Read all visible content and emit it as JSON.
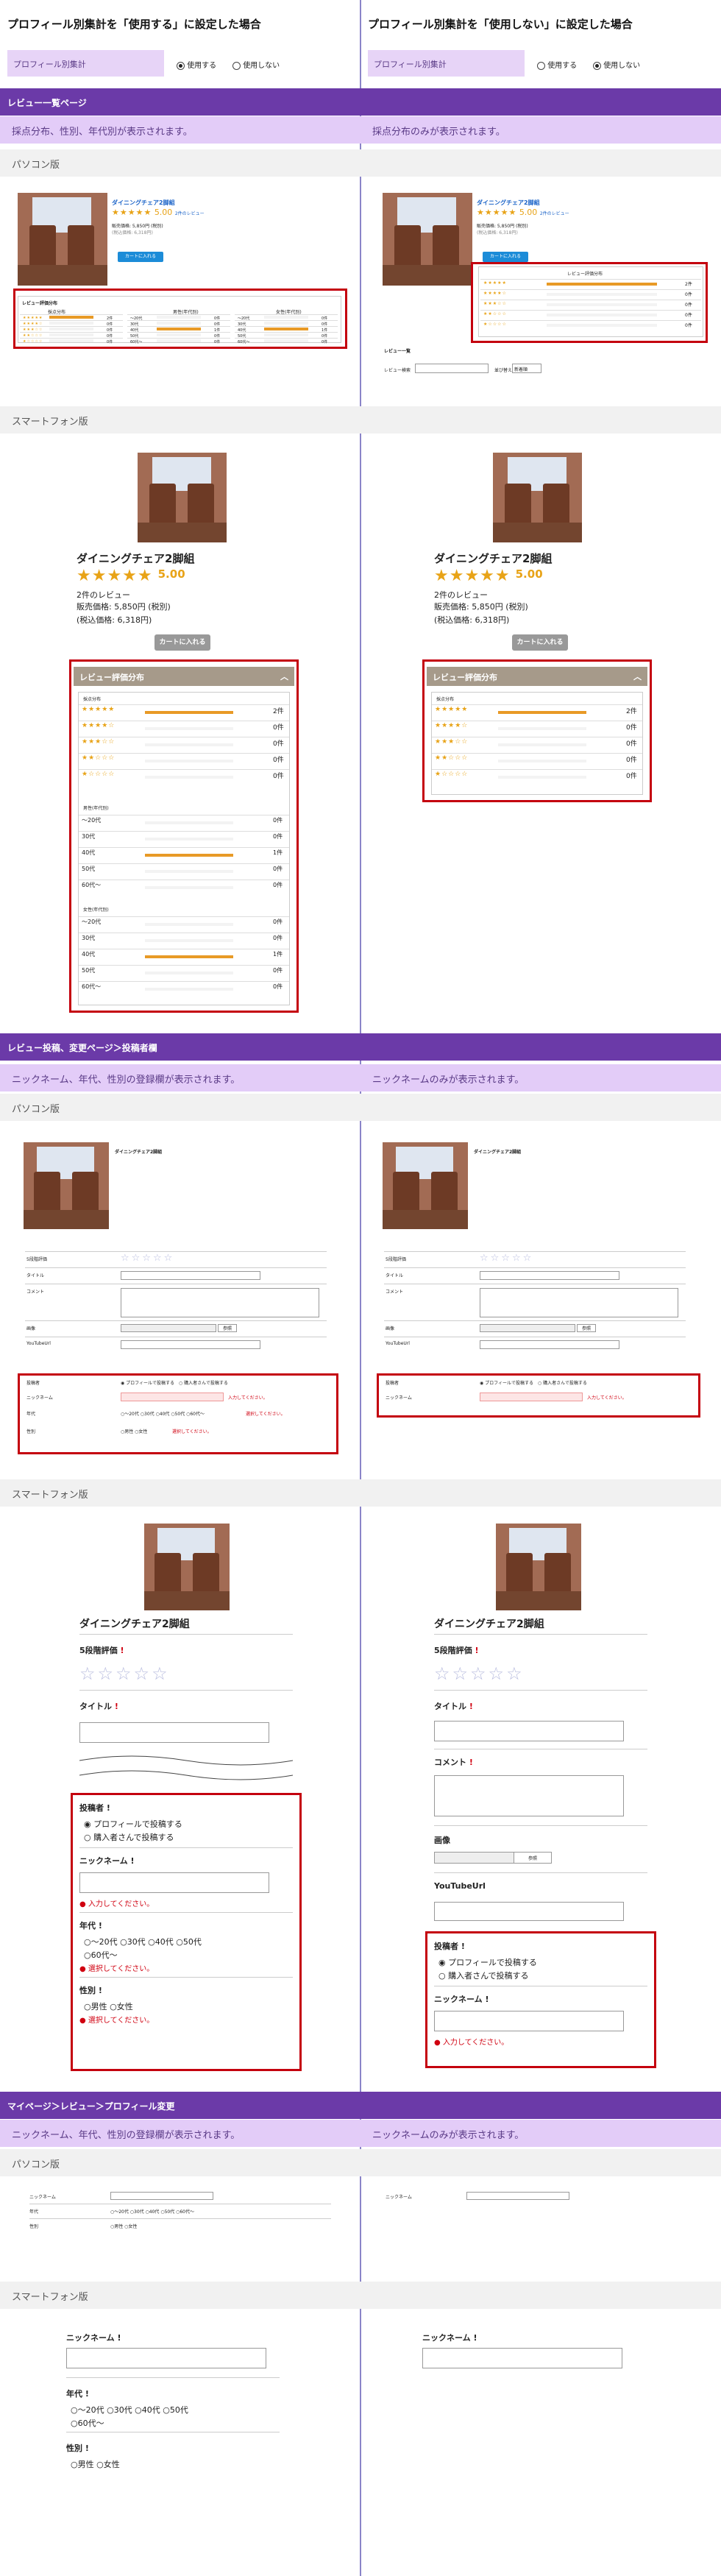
{
  "header": {
    "left_title": "プロフィール別集計を「使用する」に設定した場合",
    "right_title": "プロフィール別集計を「使用しない」に設定した場合",
    "setting_label": "プロフィール別集計",
    "opt_use": "使用する",
    "opt_nouse": "使用しない"
  },
  "sections": {
    "review_list": "レビュー一覧ページ",
    "review_post": "レビュー投稿、変更ページ＞投稿者欄",
    "mypage": "マイページ＞レビュー＞プロフィール変更"
  },
  "desc": {
    "list_left": "採点分布、性別、年代別が表示されます。",
    "list_right": "採点分布のみが表示されます。",
    "post_left": "ニックネーム、年代、性別の登録欄が表示されます。",
    "post_right": "ニックネームのみが表示されます。",
    "my_left": "ニックネーム、年代、性別の登録欄が表示されます。",
    "my_right": "ニックネームのみが表示されます。"
  },
  "sub": {
    "pc": "パソコン版",
    "sp": "スマートフォン版"
  },
  "product": {
    "name": "ダイニングチェア2脚組",
    "rating": "5.00",
    "review_count": "2件のレビュー",
    "price": "販売価格: 5,850円 (税別)",
    "price_tax": "(税込価格: 6,318円)",
    "cart": "カートに入れる",
    "stars": "★★★★★"
  },
  "review_dist": {
    "title": "レビュー評価分布",
    "score_head": "採点分布",
    "gender_head": "男性(年代別)",
    "gender_f_head": "女性(年代別)",
    "score_rows": [
      {
        "stars": "★★★★★",
        "count": "2件",
        "fill": 1.0
      },
      {
        "stars": "★★★★☆",
        "count": "0件",
        "fill": 0
      },
      {
        "stars": "★★★☆☆",
        "count": "0件",
        "fill": 0
      },
      {
        "stars": "★★☆☆☆",
        "count": "0件",
        "fill": 0
      },
      {
        "stars": "★☆☆☆☆",
        "count": "0件",
        "fill": 0
      }
    ],
    "male_rows": [
      {
        "age": "～20代",
        "count": "0件",
        "fill": 0
      },
      {
        "age": "30代",
        "count": "0件",
        "fill": 0
      },
      {
        "age": "40代",
        "count": "1件",
        "fill": 1.0
      },
      {
        "age": "50代",
        "count": "0件",
        "fill": 0
      },
      {
        "age": "60代～",
        "count": "0件",
        "fill": 0
      }
    ],
    "female_rows": [
      {
        "age": "～20代",
        "count": "0件",
        "fill": 0
      },
      {
        "age": "30代",
        "count": "0件",
        "fill": 0
      },
      {
        "age": "40代",
        "count": "1件",
        "fill": 1.0
      },
      {
        "age": "50代",
        "count": "0件",
        "fill": 0
      },
      {
        "age": "60代～",
        "count": "0件",
        "fill": 0
      }
    ],
    "pc_list_label": "レビュー一覧",
    "pc_keyword": "レビュー検索",
    "pc_sort": "並び替え",
    "pc_sort_val": "新着順"
  },
  "form": {
    "rating5": "5段階評価",
    "title": "タイトル",
    "comment": "コメント",
    "image": "画像",
    "image_btn": "参照",
    "youtube": "YouTubeUrl",
    "poster": "投稿者",
    "poster_profile": "プロフィールで投稿する",
    "poster_buyer": "購入者さんで投稿する",
    "nickname": "ニックネーム",
    "age": "年代",
    "ages": [
      "～20代",
      "30代",
      "40代",
      "50代",
      "60代～"
    ],
    "gender": "性別",
    "male": "男性",
    "female": "女性",
    "err_input": "入力してください。",
    "err_select": "選択してください。",
    "req": "!"
  }
}
